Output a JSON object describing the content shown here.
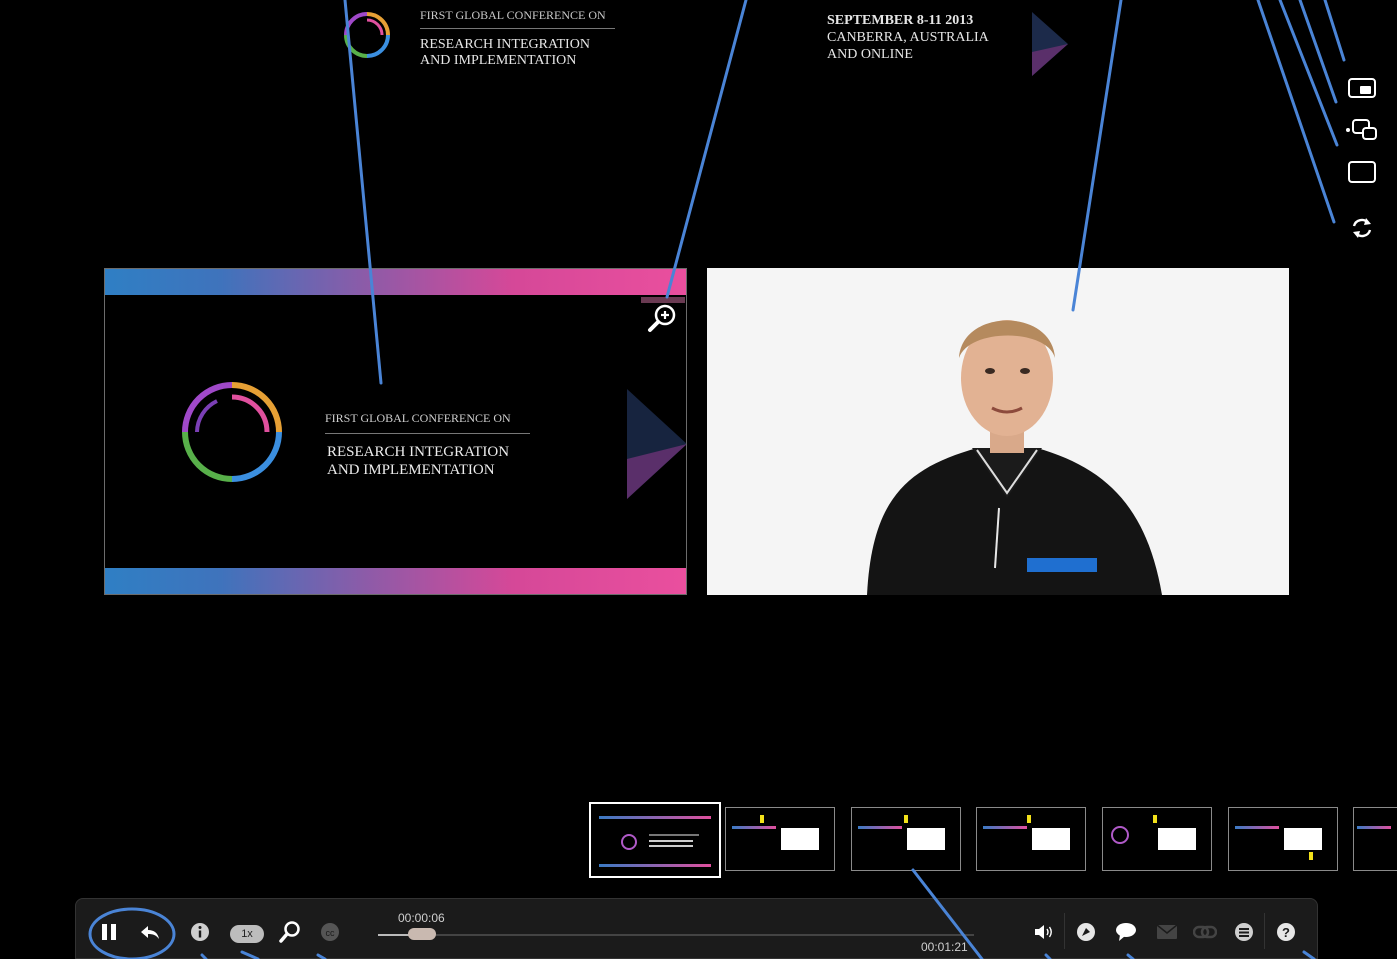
{
  "banner": {
    "small_title": "FIRST GLOBAL CONFERENCE ON",
    "title_line1": "RESEARCH INTEGRATION",
    "title_line2": "AND IMPLEMENTATION",
    "date_line1": "SEPTEMBER 8-11 2013",
    "date_line2": "CANBERRA, AUSTRALIA",
    "date_line3": "AND ONLINE"
  },
  "slide": {
    "small_title": "FIRST GLOBAL CONFERENCE ON",
    "title_line1": "RESEARCH INTEGRATION",
    "title_line2": "AND IMPLEMENTATION"
  },
  "side_icons": [
    "picture-in-picture-icon",
    "swap-layout-icon",
    "single-screen-icon",
    "refresh-icon"
  ],
  "player": {
    "current_time": "00:00:06",
    "total_time": "00:01:21",
    "speed": "1x",
    "progress_fraction": 0.074
  },
  "thumbnail_count": 7,
  "colors": {
    "accent_blue": "#3b7dd8",
    "slide_pink": "#ea4f9e",
    "slide_blue": "#2f7fc4"
  }
}
